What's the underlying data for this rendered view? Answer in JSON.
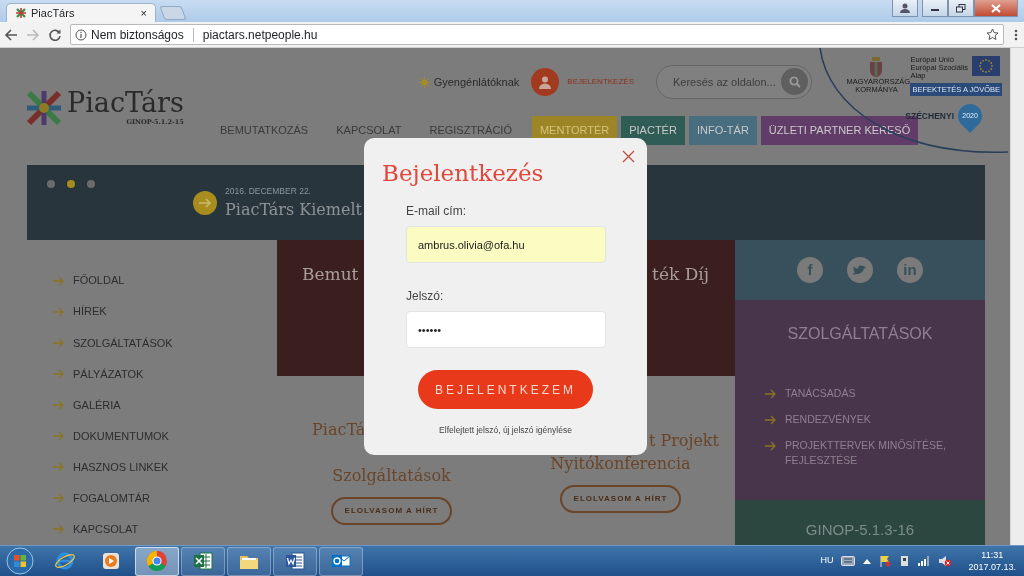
{
  "browser": {
    "tab_title": "PiacTárs",
    "tab_close": "×",
    "security_label": "Nem biztonságos",
    "url": "piactars.netpeople.hu"
  },
  "header": {
    "logo_text": "PiacTárs",
    "logo_subtitle": "GINOP-5.1.2-15",
    "accessibility_link": "Gyengénlátóknak",
    "login_link": "BEJELENTKEZÉS",
    "search": {
      "placeholder": "Keresés az oldalon..."
    },
    "eu_badge": {
      "union_lines": [
        "Európai Unió",
        "Európai Szociális",
        "Alap"
      ],
      "government": "MAGYARORSZÁG KORMÁNYA",
      "slogan": "BEFEKTETÉS A JÖVŐBE"
    },
    "szechenyi": "SZÉCHENYI",
    "szechenyi_year": "2020"
  },
  "nav": [
    {
      "label": "BEMUTATKOZÁS"
    },
    {
      "label": "KAPCSOLAT"
    },
    {
      "label": "REGISZTRÁCIÓ"
    },
    {
      "label": "MENTORTÉR",
      "color": "#9c8526"
    },
    {
      "label": "PIACTÉR",
      "color": "#2f5c55"
    },
    {
      "label": "INFO-TÁR",
      "color": "#476d7f"
    },
    {
      "label": "ÜZLETI PARTNER KERESŐ",
      "color": "#623c68"
    }
  ],
  "slider": {
    "dots": [
      {
        "selected": false
      },
      {
        "selected": true
      },
      {
        "selected": false
      }
    ],
    "date": "2016. DECEMBER 22.",
    "title": "PiacTárs Kiemelt"
  },
  "sidebar": {
    "items": [
      {
        "label": "FŐOLDAL"
      },
      {
        "label": "HÍREK"
      },
      {
        "label": "SZOLGÁLTATÁSOK"
      },
      {
        "label": "PÁLYÁZATOK"
      },
      {
        "label": "GALÉRIA"
      },
      {
        "label": "DOKUMENTUMOK"
      },
      {
        "label": "HASZNOS LINKEK"
      },
      {
        "label": "FOGALOMTÁR"
      },
      {
        "label": "KAPCSOLAT"
      }
    ]
  },
  "feature": {
    "title_left": "Bemut",
    "title_right": "ték Díj"
  },
  "news": [
    {
      "title_top": "PiacTá",
      "title_bottom": "Szolgáltatások",
      "button": "ELOLVASOM A HÍRT"
    },
    {
      "title_top": "t Projekt",
      "title_bottom": "Nyitókonferencia",
      "button": "ELOLVASOM A HÍRT"
    }
  ],
  "right_panel": {
    "social": [
      {
        "kind": "glyph",
        "glyph": "f"
      },
      {
        "kind": "bird"
      },
      {
        "kind": "glyph",
        "glyph": "in"
      }
    ],
    "services_title": "SZOLGÁLTATÁSOK",
    "services": [
      "TANÁCSADÁS",
      "RENDEZVÉNYEK",
      "PROJEKTTERVEK MINŐSÍTÉSE, FEJLESZTÉSE"
    ],
    "program": "GINOP-5.1.3-16"
  },
  "modal": {
    "title": "Bejelentkezés",
    "fields": [
      {
        "label": "E-mail cím:",
        "value": "ambrus.olivia@ofa.hu",
        "autofilled": true
      },
      {
        "label": "Jelszó:",
        "value": "••••••",
        "autofilled": false
      }
    ],
    "submit": "BEJELENTKEZEM",
    "forgot_link": "Elfelejtett jelszó, új jelszó igénylése"
  },
  "taskbar": {
    "apps": [
      {
        "kind": "globe",
        "running": false,
        "selected": false
      },
      {
        "kind": "play",
        "running": false,
        "selected": false
      },
      {
        "kind": "wheel",
        "running": true,
        "selected": true
      },
      {
        "kind": "sheet",
        "running": true,
        "selected": false
      },
      {
        "kind": "folder",
        "running": true,
        "selected": false
      },
      {
        "kind": "doc",
        "running": true,
        "selected": false
      },
      {
        "kind": "mail",
        "running": true,
        "selected": false
      }
    ],
    "language": "HU",
    "time": "11:31",
    "date": "2017.07.13."
  }
}
